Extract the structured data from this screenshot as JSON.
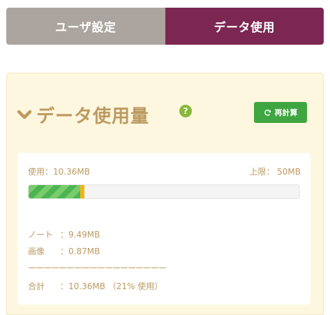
{
  "tabs": [
    {
      "label": "ユーザ設定",
      "active": false
    },
    {
      "label": "データ使用",
      "active": true
    }
  ],
  "header": {
    "title": "データ使用量",
    "help_symbol": "?",
    "recalc_label": "再計算"
  },
  "usage": {
    "used_text": "使用：10.36MB",
    "limit_text": "上限： 50MB",
    "notes_fraction": 0.1898,
    "images_fraction": 0.0174,
    "notes_color": "#4db552",
    "images_color": "#f4b21b"
  },
  "breakdown": {
    "notes_label": "ノート",
    "notes_value": "：9.49MB",
    "images_label": "画像",
    "images_value": "：0.87MB",
    "divider": "ーーーーーーーーーーーーーーーーーー",
    "total_label": "合計",
    "total_value": "：10.36MB （21% 使用）"
  },
  "colors": {
    "accent": "#7b2752",
    "muted_tab": "#aca49e",
    "title": "#bc9a60",
    "button": "#3fa540",
    "panel": "#fdf7df"
  }
}
